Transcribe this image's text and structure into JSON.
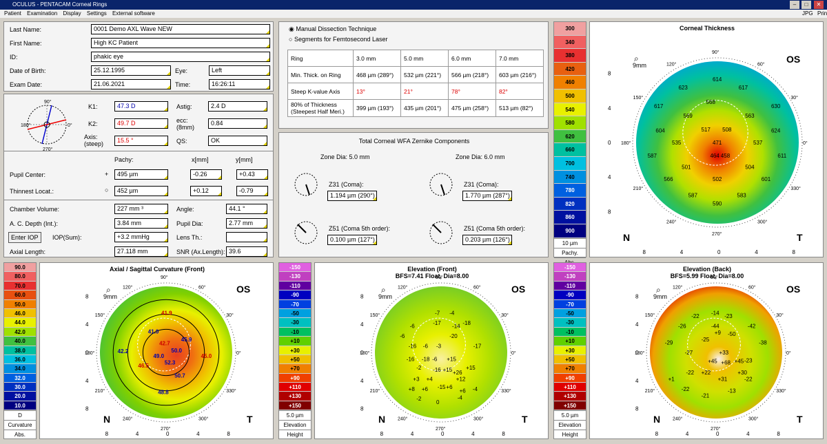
{
  "window": {
    "title": "OCULUS - PENTACAM Corneal Rings",
    "minimize": "–",
    "maximize": "□",
    "close": "✕"
  },
  "menu": [
    "Patient",
    "Examination",
    "Display",
    "Settings",
    "External software"
  ],
  "menu_right": [
    "JPG",
    "Print"
  ],
  "patient": {
    "last_name_label": "Last Name:",
    "last_name": "0001 Demo AXL Wave NEW",
    "first_name_label": "First Name:",
    "first_name": "High KC Patient",
    "id_label": "ID:",
    "id": "phakic eye",
    "dob_label": "Date of Birth:",
    "dob": "25.12.1995",
    "eye_label": "Eye:",
    "eye": "Left",
    "exam_label": "Exam Date:",
    "exam": "21.06.2021",
    "time_label": "Time:",
    "time": "16:26:11"
  },
  "kvals": {
    "k1_label": "K1:",
    "k1": "47.3 D",
    "k2_label": "K2:",
    "k2": "49.7 D",
    "axis_label": "Axis:\n(steep)",
    "axis": "15.5 °",
    "astig_label": "Astig:",
    "astig": "2.4 D",
    "ecc_label": "ecc:\n(8mm)",
    "ecc": "0.84",
    "qs_label": "QS:",
    "qs": "OK",
    "deg": {
      "top": "90°",
      "left": "180°",
      "bottom": "270°",
      "right": "0°"
    }
  },
  "pachy": {
    "pachy_h": "Pachy:",
    "x_h": "x[mm]",
    "y_h": "y[mm]",
    "pupil_label": "Pupil Center:",
    "pupil_sym": "+",
    "pupil_p": "495 µm",
    "pupil_x": "-0.26",
    "pupil_y": "+0.43",
    "thin_label": "Thinnest Locat.:",
    "thin_sym": "○",
    "thin_p": "452 µm",
    "thin_x": "+0.12",
    "thin_y": "-0.79"
  },
  "chamber": {
    "cv_label": "Chamber Volume:",
    "cv": "227 mm ³",
    "angle_label": "Angle:",
    "angle": "44.1 °",
    "acd_label": "A. C. Depth (Int.):",
    "acd": "3.84 mm",
    "pdia_label": "Pupil Dia:",
    "pdia": "2.77 mm",
    "iop_btn": "Enter IOP",
    "iop_label": "IOP(Sum):",
    "iop": "+3.2 mmHg",
    "lens_label": "Lens Th.:",
    "lens": "",
    "al_label": "Axial Length:",
    "al": "27.118 mm",
    "snr_label": "SNR (Ax.Length):",
    "snr": "39.6"
  },
  "rings": {
    "opt1": "Manual Dissection Technique",
    "opt2": "Segments for Femtosecond Laser",
    "headers": [
      "Ring",
      "3.0 mm",
      "5.0 mm",
      "6.0 mm",
      "7.0 mm"
    ],
    "rows": [
      [
        "Min. Thick. on Ring",
        "468 µm (289°)",
        "532 µm (221°)",
        "566 µm (218°)",
        "603 µm (216°)"
      ],
      [
        "Steep K-value Axis",
        "13°",
        "21°",
        "78°",
        "82°"
      ],
      [
        "80% of Thickness\n(Steepest Half Meri.)",
        "399 µm (193°)",
        "435 µm (201°)",
        "475 µm (258°)",
        "513 µm (82°)"
      ]
    ]
  },
  "zernike": {
    "title": "Total Corneal WFA Zernike Components",
    "zone1": "Zone Dia: 5.0 mm",
    "zone2": "Zone Dia: 6.0 mm",
    "z31_label": "Z31 (Coma):",
    "z51_label": "Z51 (Coma 5th order):",
    "z31_a": "1.194 µm (290°)",
    "z51_a": "0.100 µm (127°)",
    "z31_b": "1.770 µm (287°)",
    "z51_b": "0.203 µm (126°)"
  },
  "pachy_scale": {
    "values": [
      "300",
      "340",
      "380",
      "420",
      "460",
      "500",
      "540",
      "580",
      "620",
      "660",
      "700",
      "740",
      "780",
      "820",
      "860",
      "900"
    ],
    "colors": [
      "#f0a0a0",
      "#f06060",
      "#e83030",
      "#e86010",
      "#f08000",
      "#f0c000",
      "#e8f000",
      "#a0e000",
      "#40c040",
      "#00c0a0",
      "#00c0e0",
      "#0090e0",
      "#0060e0",
      "#0030c0",
      "#0010a0",
      "#000080"
    ],
    "foot": [
      "10 µm",
      "Pachy.",
      "Abs."
    ]
  },
  "curv_scale": {
    "values": [
      "90.0",
      "80.0",
      "70.0",
      "60.0",
      "50.0",
      "46.0",
      "44.0",
      "42.0",
      "40.0",
      "38.0",
      "36.0",
      "34.0",
      "32.0",
      "30.0",
      "20.0",
      "10.0"
    ],
    "colors": [
      "#f0a0a0",
      "#f06060",
      "#e83030",
      "#e85010",
      "#f08000",
      "#f0c000",
      "#e8f000",
      "#a0e000",
      "#40c040",
      "#00c0a0",
      "#00c0e0",
      "#0090e0",
      "#0060e0",
      "#0030c0",
      "#0010a0",
      "#000080"
    ],
    "foot": [
      "D",
      "Curvature",
      "Abs."
    ]
  },
  "elev_scale": {
    "values": [
      "-150",
      "-130",
      "-110",
      "-90",
      "-70",
      "-50",
      "-30",
      "-10",
      "+10",
      "+30",
      "+50",
      "+70",
      "+90",
      "+110",
      "+130",
      "+150"
    ],
    "colors": [
      "#e060e0",
      "#c040c0",
      "#6000a0",
      "#0000c0",
      "#0040e0",
      "#00a0e0",
      "#00c0c0",
      "#00c060",
      "#60d000",
      "#e8f000",
      "#f0c000",
      "#f08000",
      "#f04000",
      "#e00000",
      "#b00000",
      "#800000"
    ],
    "foot": [
      "5.0 µm",
      "Elevation",
      "Height"
    ]
  },
  "maps": {
    "thickness": {
      "title": "Corneal Thickness",
      "subtitle": "",
      "eye": "OS",
      "zoom": "9mm",
      "vals": [
        "614",
        "623",
        "617",
        "568",
        "617",
        "630",
        "569",
        "563",
        "517",
        "508",
        "604",
        "624",
        "535",
        "471",
        "537",
        "587",
        "464",
        "458",
        "611",
        "501",
        "504",
        "566",
        "502",
        "601",
        "587",
        "583",
        "590"
      ]
    },
    "axial": {
      "title": "Axial / Sagittal Curvature (Front)",
      "subtitle": "",
      "eye": "OS",
      "zoom": "9mm",
      "vals": [
        "41.9",
        "41.0",
        "45.9",
        "42.7",
        "42.2",
        "50.0",
        "45.0",
        "49.0",
        "52.3",
        "46.5",
        "50.7",
        "48.8"
      ]
    },
    "elev_front": {
      "title": "Elevation (Front)",
      "subtitle": "BFS=7.41 Float, Dia=8.00",
      "eye": "OS",
      "zoom": "9mm",
      "vals": [
        "-7",
        "-4",
        "-17",
        "-18",
        "-6",
        "-14",
        "-6",
        "-20",
        "-16",
        "-6",
        "-3",
        "-17",
        "-16",
        "-18",
        "-6",
        "+15",
        "-2",
        "-16",
        "+15",
        "+26",
        "+15",
        "+3",
        "+4",
        "+12",
        "-15",
        "+8",
        "+6",
        "+6",
        "+6",
        "-4",
        "-2",
        "0",
        "-4"
      ]
    },
    "elev_back": {
      "title": "Elevation (Back)",
      "subtitle": "BFS=5.99 Float, Dia=8.00",
      "eye": "OS",
      "zoom": "9mm",
      "vals": [
        "-14",
        "-22",
        "-23",
        "-26",
        "-44",
        "-42",
        "-29",
        "-25",
        "-50",
        "-38",
        "+9",
        "-27",
        "+33",
        "-23",
        "+45",
        "+68",
        "+45",
        "-22",
        "+22",
        "+30",
        "+1",
        "+31",
        "-22",
        "-22",
        "-21",
        "-13"
      ]
    }
  },
  "axis_labels": {
    "deg": [
      "90°",
      "60°",
      "30°",
      "0°",
      "330°",
      "300°",
      "270°",
      "240°",
      "210°",
      "180°",
      "150°",
      "120°"
    ],
    "y": [
      "8",
      "4",
      "0",
      "4",
      "8"
    ],
    "x": [
      "8",
      "4",
      "0",
      "4",
      "8"
    ],
    "n": "N",
    "t": "T",
    "um": "µm"
  }
}
